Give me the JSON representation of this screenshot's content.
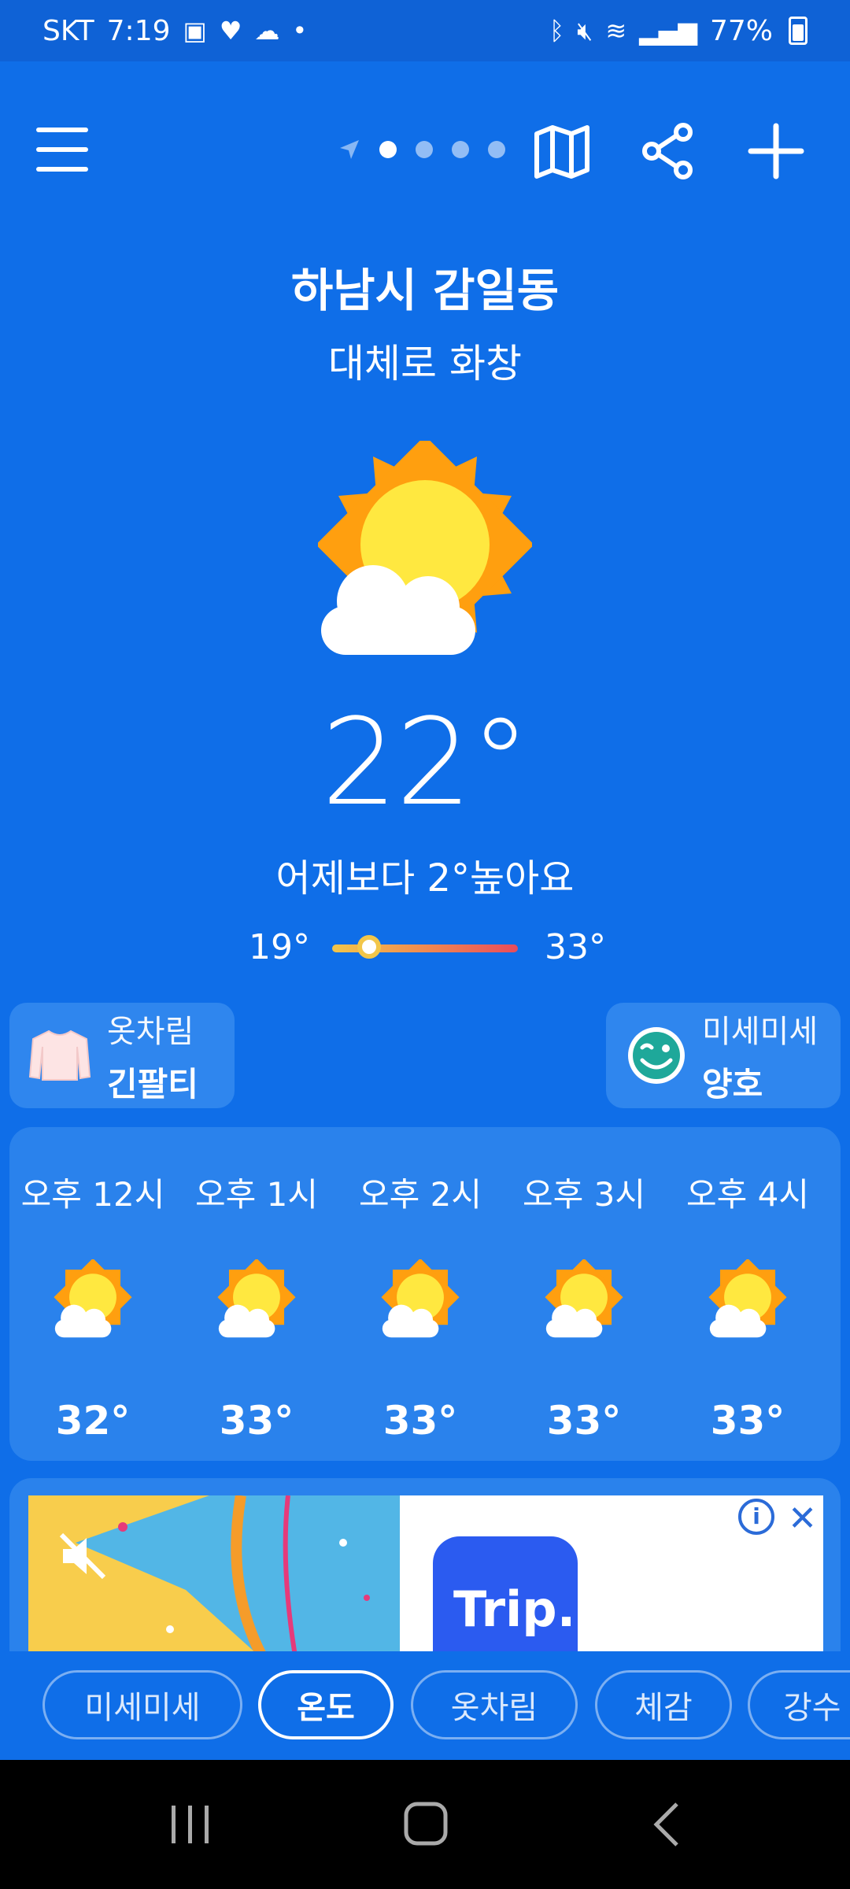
{
  "status": {
    "carrier": "SKT",
    "time": "7:19",
    "battery": "77%"
  },
  "location": "하남시 감일동",
  "condition": "대체로 화창",
  "current_temp": "22°",
  "compare_text": "어제보다 2°높아요",
  "temp_range": {
    "low": "19°",
    "high": "33°",
    "current_position": 0.2
  },
  "chips": {
    "outfit": {
      "label": "옷차림",
      "value": "긴팔티"
    },
    "dust": {
      "label": "미세미세",
      "value": "양호"
    }
  },
  "hourly": [
    {
      "hour": "오후 12시",
      "temp": "32°",
      "icon": "sun-cloud-icon"
    },
    {
      "hour": "오후 1시",
      "temp": "33°",
      "icon": "sun-cloud-icon"
    },
    {
      "hour": "오후 2시",
      "temp": "33°",
      "icon": "sun-cloud-icon"
    },
    {
      "hour": "오후 3시",
      "temp": "33°",
      "icon": "sun-cloud-icon"
    },
    {
      "hour": "오후 4시",
      "temp": "33°",
      "icon": "sun-cloud-icon"
    }
  ],
  "ad": {
    "brand_text": "Trip."
  },
  "tabs": [
    {
      "label": "미세미세",
      "active": false
    },
    {
      "label": "온도",
      "active": true
    },
    {
      "label": "옷차림",
      "active": false
    },
    {
      "label": "체감",
      "active": false
    },
    {
      "label": "강수",
      "active": false
    }
  ],
  "colors": {
    "background": "#0f6ee8",
    "card": "#2a82ec",
    "sun": "#ffe840",
    "sun_rays": "#ff9f0f"
  }
}
